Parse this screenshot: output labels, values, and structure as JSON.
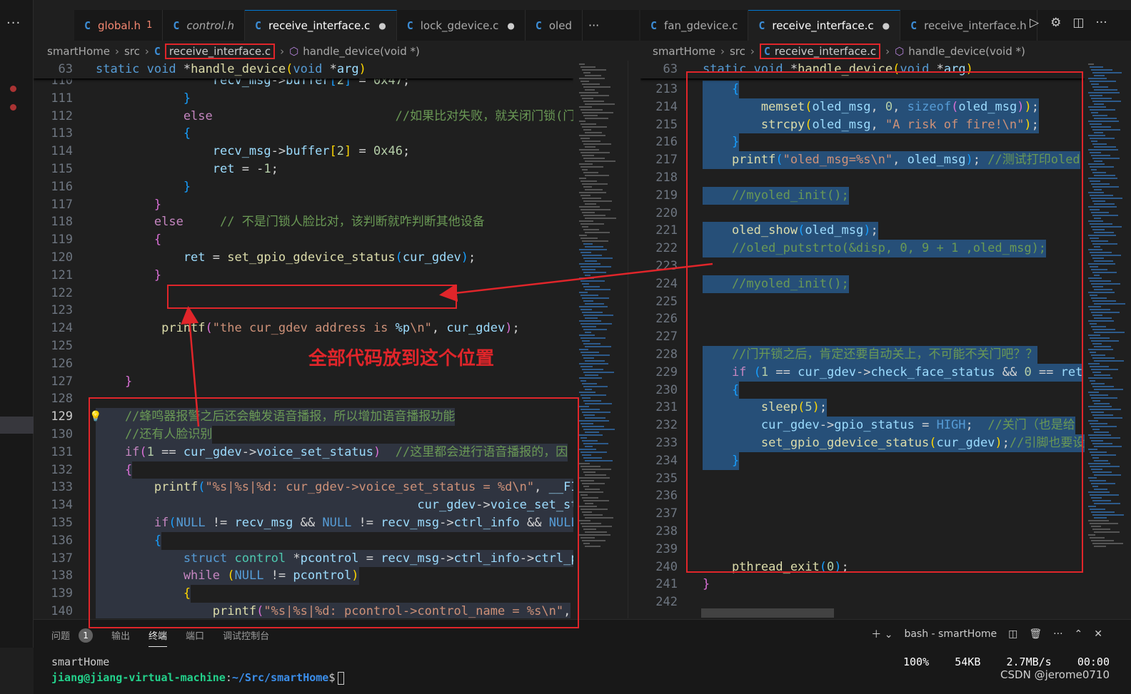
{
  "left_tabs": [
    {
      "label": "global.h",
      "badge": "1",
      "status": "error"
    },
    {
      "label": "control.h",
      "status": "italic"
    },
    {
      "label": "receive_interface.c",
      "dot": "●",
      "status": "active"
    },
    {
      "label": "lock_gdevice.c",
      "dot": "●"
    },
    {
      "label": "oled"
    }
  ],
  "right_tabs": [
    {
      "label": "fan_gdevice.c"
    },
    {
      "label": "receive_interface.c",
      "dot": "●",
      "status": "active"
    },
    {
      "label": "receive_interface.h"
    }
  ],
  "more_glyph": "···",
  "tab_glyph": "C",
  "left_breadcrumb": {
    "root": "smartHome",
    "dir": "src",
    "file": "receive_interface.c",
    "symbol": "handle_device(void *)"
  },
  "right_breadcrumb": {
    "root": "smartHome",
    "dir": "src",
    "file": "receive_interface.c",
    "symbol": "handle_device(void *)"
  },
  "left_sticky": {
    "num": "63",
    "tokens": [
      [
        "kw",
        "static "
      ],
      [
        "kw",
        "void "
      ],
      [
        "pl",
        "*"
      ],
      [
        "fn",
        "handle_device"
      ],
      [
        "br1",
        "("
      ],
      [
        "kw",
        "void "
      ],
      [
        "pl",
        "*"
      ],
      [
        "vr",
        "arg"
      ],
      [
        "br1",
        ")"
      ]
    ]
  },
  "right_sticky": {
    "num": "63",
    "tokens": [
      [
        "kw",
        "static "
      ],
      [
        "kw",
        "void "
      ],
      [
        "pl",
        "*"
      ],
      [
        "fn",
        "handle_device"
      ],
      [
        "br1",
        "("
      ],
      [
        "kw",
        "void "
      ],
      [
        "pl",
        "*"
      ],
      [
        "vr",
        "arg"
      ],
      [
        "br1",
        ")"
      ]
    ]
  },
  "left_lines": [
    {
      "n": "110",
      "t": [
        [
          "vr",
          "                recv_msg"
        ],
        [
          "pl",
          "->"
        ],
        [
          "vr",
          "buffer"
        ],
        [
          "br3",
          "["
        ],
        [
          "nm",
          "2"
        ],
        [
          "br3",
          "]"
        ],
        [
          "pl",
          " = "
        ],
        [
          "nm",
          "0x47"
        ],
        [
          "pl",
          ";"
        ]
      ]
    },
    {
      "n": "111",
      "t": [
        [
          "br3",
          "            }"
        ]
      ]
    },
    {
      "n": "112",
      "t": [
        [
          "ct",
          "            else"
        ],
        [
          "cm",
          "                         //如果比对失败，就关闭门锁(门"
        ]
      ]
    },
    {
      "n": "113",
      "t": [
        [
          "br3",
          "            {"
        ]
      ]
    },
    {
      "n": "114",
      "t": [
        [
          "vr",
          "                recv_msg"
        ],
        [
          "pl",
          "->"
        ],
        [
          "vr",
          "buffer"
        ],
        [
          "br1",
          "["
        ],
        [
          "nm",
          "2"
        ],
        [
          "br1",
          "]"
        ],
        [
          "pl",
          " = "
        ],
        [
          "nm",
          "0x46"
        ],
        [
          "pl",
          ";"
        ]
      ]
    },
    {
      "n": "115",
      "t": [
        [
          "vr",
          "                ret"
        ],
        [
          "pl",
          " = -"
        ],
        [
          "nm",
          "1"
        ],
        [
          "pl",
          ";"
        ]
      ]
    },
    {
      "n": "116",
      "t": [
        [
          "br3",
          "            }"
        ]
      ]
    },
    {
      "n": "117",
      "t": [
        [
          "br2",
          "        }"
        ]
      ]
    },
    {
      "n": "118",
      "t": [
        [
          "ct",
          "        else"
        ],
        [
          "cm",
          "     // 不是门锁人脸比对，该判断就咋判断其他设备"
        ]
      ]
    },
    {
      "n": "119",
      "t": [
        [
          "br2",
          "        {"
        ]
      ]
    },
    {
      "n": "120",
      "t": [
        [
          "vr",
          "            ret"
        ],
        [
          "pl",
          " = "
        ],
        [
          "fn",
          "set_gpio_gdevice_status"
        ],
        [
          "br3",
          "("
        ],
        [
          "vr",
          "cur_gdev"
        ],
        [
          "br3",
          ")"
        ],
        [
          "pl",
          ";"
        ]
      ]
    },
    {
      "n": "121",
      "t": [
        [
          "br2",
          "        }"
        ]
      ]
    },
    {
      "n": "122",
      "t": [
        [
          "pl",
          ""
        ]
      ]
    },
    {
      "n": "123",
      "t": [
        [
          "pl",
          ""
        ]
      ]
    },
    {
      "n": "124",
      "t": [
        [
          "fn",
          "         printf"
        ],
        [
          "br2",
          "("
        ],
        [
          "st",
          "\"the cur_gdev address is "
        ],
        [
          "vr",
          "%p"
        ],
        [
          "st",
          "\\n\""
        ],
        [
          "pl",
          ", "
        ],
        [
          "vr",
          "cur_gdev"
        ],
        [
          "br2",
          ")"
        ],
        [
          "pl",
          ";"
        ]
      ]
    },
    {
      "n": "125",
      "t": [
        [
          "pl",
          ""
        ]
      ]
    },
    {
      "n": "126",
      "t": [
        [
          "pl",
          ""
        ]
      ]
    },
    {
      "n": "127",
      "t": [
        [
          "br2",
          "    }"
        ]
      ]
    },
    {
      "n": "128",
      "t": [
        [
          "pl",
          ""
        ]
      ]
    },
    {
      "n": "129",
      "cur": true,
      "hl": true,
      "t": [
        [
          "cm",
          "    //蜂鸣器报警之后还会触发语音播报，所以增加语音播报功能"
        ]
      ]
    },
    {
      "n": "130",
      "hl": true,
      "t": [
        [
          "cm",
          "    //还有人脸识别"
        ]
      ]
    },
    {
      "n": "131",
      "hl": true,
      "t": [
        [
          "ct",
          "    if"
        ],
        [
          "br2",
          "("
        ],
        [
          "nm",
          "1"
        ],
        [
          "pl",
          " == "
        ],
        [
          "vr",
          "cur_gdev"
        ],
        [
          "pl",
          "->"
        ],
        [
          "vr",
          "voice_set_status"
        ],
        [
          "br2",
          ")"
        ],
        [
          "cm",
          "  //这里都会进行语音播报的，因"
        ]
      ]
    },
    {
      "n": "132",
      "hl": true,
      "t": [
        [
          "br2",
          "    {"
        ]
      ]
    },
    {
      "n": "133",
      "hl": true,
      "t": [
        [
          "fn",
          "        printf"
        ],
        [
          "br3",
          "("
        ],
        [
          "st",
          "\"%s|%s|%d: cur_gdev->voice_set_status = %d\\n\""
        ],
        [
          "pl",
          ", "
        ],
        [
          "vr",
          "__FI"
        ]
      ]
    },
    {
      "n": "134",
      "hl": true,
      "t": [
        [
          "vr",
          "                                            cur_gdev"
        ],
        [
          "pl",
          "->"
        ],
        [
          "vr",
          "voice_set_status"
        ],
        [
          "br3",
          ")"
        ],
        [
          "pl",
          ";"
        ]
      ]
    },
    {
      "n": "135",
      "hl": true,
      "t": [
        [
          "ct",
          "        if"
        ],
        [
          "br3",
          "("
        ],
        [
          "kw",
          "NULL"
        ],
        [
          "pl",
          " != "
        ],
        [
          "vr",
          "recv_msg"
        ],
        [
          "pl",
          " && "
        ],
        [
          "kw",
          "NULL"
        ],
        [
          "pl",
          " != "
        ],
        [
          "vr",
          "recv_msg"
        ],
        [
          "pl",
          "->"
        ],
        [
          "vr",
          "ctrl_info"
        ],
        [
          "pl",
          " && "
        ],
        [
          "kw",
          "NULL"
        ]
      ]
    },
    {
      "n": "136",
      "hl": true,
      "t": [
        [
          "br3",
          "        {"
        ]
      ]
    },
    {
      "n": "137",
      "hl": true,
      "t": [
        [
          "kw",
          "            struct "
        ],
        [
          "ty",
          "control "
        ],
        [
          "pl",
          "*"
        ],
        [
          "vr",
          "pcontrol"
        ],
        [
          "pl",
          " = "
        ],
        [
          "vr",
          "recv_msg"
        ],
        [
          "pl",
          "->"
        ],
        [
          "vr",
          "ctrl_info"
        ],
        [
          "pl",
          "->"
        ],
        [
          "vr",
          "ctrl_p"
        ]
      ]
    },
    {
      "n": "138",
      "hl": true,
      "t": [
        [
          "ct",
          "            while"
        ],
        [
          "br1",
          " ("
        ],
        [
          "kw",
          "NULL"
        ],
        [
          "pl",
          " != "
        ],
        [
          "vr",
          "pcontrol"
        ],
        [
          "br1",
          ")"
        ]
      ]
    },
    {
      "n": "139",
      "hl": true,
      "t": [
        [
          "br1",
          "            {"
        ]
      ]
    },
    {
      "n": "140",
      "hl": true,
      "t": [
        [
          "fn",
          "                printf"
        ],
        [
          "br2",
          "("
        ],
        [
          "st",
          "\"%s|%s|%d: pcontrol->control_name = %s\\n\""
        ],
        [
          "pl",
          ","
        ]
      ]
    }
  ],
  "right_lines": [
    {
      "n": "213",
      "hl": true,
      "t": [
        [
          "br3",
          "    {"
        ]
      ]
    },
    {
      "n": "214",
      "hl": true,
      "t": [
        [
          "fn",
          "        memset"
        ],
        [
          "br1",
          "("
        ],
        [
          "vr",
          "oled_msg"
        ],
        [
          "pl",
          ", "
        ],
        [
          "nm",
          "0"
        ],
        [
          "pl",
          ", "
        ],
        [
          "kw",
          "sizeof"
        ],
        [
          "br2",
          "("
        ],
        [
          "vr",
          "oled_msg"
        ],
        [
          "br2",
          ")"
        ],
        [
          "br1",
          ")"
        ],
        [
          "pl",
          ";"
        ]
      ]
    },
    {
      "n": "215",
      "hl": true,
      "t": [
        [
          "fn",
          "        strcpy"
        ],
        [
          "br1",
          "("
        ],
        [
          "vr",
          "oled_msg"
        ],
        [
          "pl",
          ", "
        ],
        [
          "st",
          "\"A risk of fire!\\n\""
        ],
        [
          "br1",
          ")"
        ],
        [
          "pl",
          ";"
        ]
      ]
    },
    {
      "n": "216",
      "hl": true,
      "t": [
        [
          "br3",
          "    }"
        ]
      ]
    },
    {
      "n": "217",
      "hl": true,
      "t": [
        [
          "fn",
          "    printf"
        ],
        [
          "br3",
          "("
        ],
        [
          "st",
          "\"oled_msg=%s\\n\""
        ],
        [
          "pl",
          ", "
        ],
        [
          "vr",
          "oled_msg"
        ],
        [
          "br3",
          ")"
        ],
        [
          "pl",
          "; "
        ],
        [
          "cm",
          "//测试打印oled"
        ]
      ]
    },
    {
      "n": "218",
      "hl": true,
      "t": [
        [
          "pl",
          ""
        ]
      ]
    },
    {
      "n": "219",
      "hl": true,
      "t": [
        [
          "cm",
          "    //myoled_init();"
        ]
      ]
    },
    {
      "n": "220",
      "hl": true,
      "t": [
        [
          "pl",
          ""
        ]
      ]
    },
    {
      "n": "221",
      "hl": true,
      "t": [
        [
          "fn",
          "    oled_show"
        ],
        [
          "br3",
          "("
        ],
        [
          "vr",
          "oled_msg"
        ],
        [
          "br3",
          ")"
        ],
        [
          "pl",
          ";"
        ]
      ]
    },
    {
      "n": "222",
      "hl": true,
      "t": [
        [
          "cm",
          "    //oled_putstrto(&disp, 0, 9 + 1 ,oled_msg);"
        ]
      ]
    },
    {
      "n": "223",
      "hl": true,
      "t": [
        [
          "pl",
          ""
        ]
      ]
    },
    {
      "n": "224",
      "hl": true,
      "t": [
        [
          "cm",
          "    //myoled_init();"
        ]
      ]
    },
    {
      "n": "225",
      "hl": true,
      "t": [
        [
          "pl",
          ""
        ]
      ]
    },
    {
      "n": "226",
      "hl": true,
      "t": [
        [
          "pl",
          ""
        ]
      ]
    },
    {
      "n": "227",
      "hl": true,
      "t": [
        [
          "pl",
          ""
        ]
      ]
    },
    {
      "n": "228",
      "hl": true,
      "t": [
        [
          "cm",
          "    //门开锁之后，肯定还要自动关上，不可能不关门吧？？"
        ]
      ]
    },
    {
      "n": "229",
      "hl": true,
      "t": [
        [
          "ct",
          "    if"
        ],
        [
          "br3",
          " ("
        ],
        [
          "nm",
          "1"
        ],
        [
          "pl",
          " == "
        ],
        [
          "vr",
          "cur_gdev"
        ],
        [
          "pl",
          "->"
        ],
        [
          "vr",
          "check_face_status"
        ],
        [
          "pl",
          " && "
        ],
        [
          "nm",
          "0"
        ],
        [
          "pl",
          " == "
        ],
        [
          "vr",
          "ret"
        ]
      ]
    },
    {
      "n": "230",
      "hl": true,
      "t": [
        [
          "br3",
          "    {"
        ]
      ]
    },
    {
      "n": "231",
      "hl": true,
      "t": [
        [
          "fn",
          "        sleep"
        ],
        [
          "br1",
          "("
        ],
        [
          "nm",
          "5"
        ],
        [
          "br1",
          ")"
        ],
        [
          "pl",
          ";"
        ]
      ]
    },
    {
      "n": "232",
      "hl": true,
      "t": [
        [
          "vr",
          "        cur_gdev"
        ],
        [
          "pl",
          "->"
        ],
        [
          "vr",
          "gpio_status"
        ],
        [
          "pl",
          " = "
        ],
        [
          "kw",
          "HIGH"
        ],
        [
          "pl",
          ";  "
        ],
        [
          "cm",
          "//关门（也是给"
        ]
      ]
    },
    {
      "n": "233",
      "hl": true,
      "t": [
        [
          "fn",
          "        set_gpio_gdevice_status"
        ],
        [
          "br1",
          "("
        ],
        [
          "vr",
          "cur_gdev"
        ],
        [
          "br1",
          ")"
        ],
        [
          "pl",
          ";"
        ],
        [
          "cm",
          "//引脚也要设"
        ]
      ]
    },
    {
      "n": "234",
      "hl": true,
      "t": [
        [
          "br3",
          "    }"
        ]
      ]
    },
    {
      "n": "235",
      "hl": true,
      "t": [
        [
          "pl",
          ""
        ]
      ]
    },
    {
      "n": "236",
      "hl": true,
      "t": [
        [
          "pl",
          ""
        ]
      ]
    },
    {
      "n": "237",
      "hl": true,
      "t": [
        [
          "pl",
          ""
        ]
      ]
    },
    {
      "n": "238",
      "hl": true,
      "t": [
        [
          "pl",
          ""
        ]
      ]
    },
    {
      "n": "239",
      "t": [
        [
          "pl",
          ""
        ]
      ]
    },
    {
      "n": "240",
      "t": [
        [
          "fn",
          "    pthread_exit"
        ],
        [
          "br3",
          "("
        ],
        [
          "nm",
          "0"
        ],
        [
          "br3",
          ")"
        ],
        [
          "pl",
          ";"
        ]
      ]
    },
    {
      "n": "241",
      "t": [
        [
          "br2",
          "}"
        ]
      ]
    },
    {
      "n": "242",
      "t": [
        [
          "pl",
          ""
        ]
      ]
    }
  ],
  "annotation": "全部代码放到这个位置",
  "panel": {
    "tabs": [
      "问题",
      "输出",
      "终端",
      "端口",
      "调试控制台"
    ],
    "problems_count": "1",
    "active_tab": "终端",
    "terminal_name": "bash - smartHome",
    "term_line1": "smartHome",
    "prompt_user": "jiang@jiang-virtual-machine",
    "prompt_path": "~/Src/smartHome",
    "prompt_sym": "$",
    "stats": "100%    54KB    2.7MB/s    00:00",
    "watermark": "CSDN @jerome0710"
  },
  "colors": {
    "accent": "#0078d4",
    "annotation_red": "#e0252a",
    "selection": "#264f78"
  }
}
